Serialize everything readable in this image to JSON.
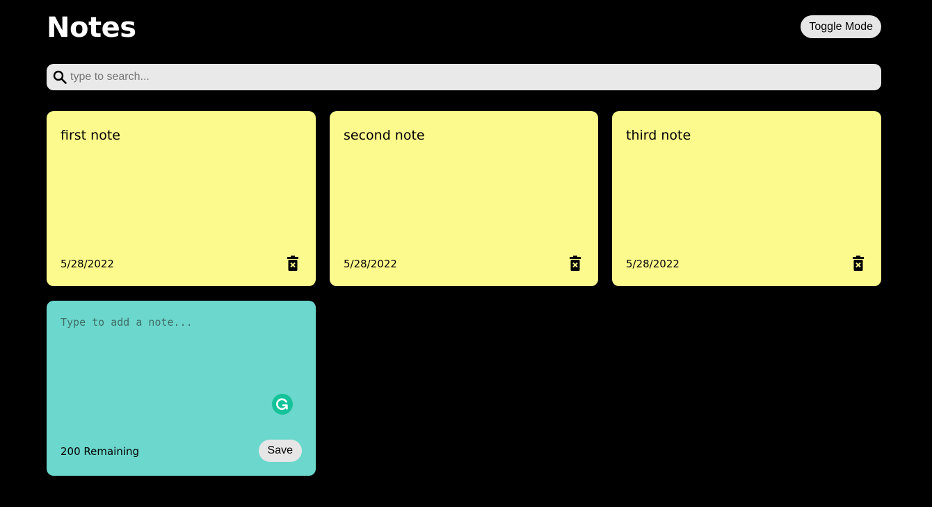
{
  "header": {
    "title": "Notes",
    "toggle_label": "Toggle Mode"
  },
  "search": {
    "placeholder": "type to search...",
    "value": "",
    "icon": "search-icon"
  },
  "notes": [
    {
      "text": "first note",
      "date": "5/28/2022",
      "delete_icon": "trash-icon"
    },
    {
      "text": "second note",
      "date": "5/28/2022",
      "delete_icon": "trash-icon"
    },
    {
      "text": "third note",
      "date": "5/28/2022",
      "delete_icon": "trash-icon"
    }
  ],
  "add_note": {
    "placeholder": "Type to add a note...",
    "value": "",
    "remaining": "200 Remaining",
    "save_label": "Save",
    "assistant_icon": "grammarly-icon"
  },
  "colors": {
    "background": "#000000",
    "note": "#fcfa8c",
    "new_note": "#6cd7cc",
    "button": "#e6e6e6",
    "search": "#e9e9e9",
    "grammarly": "#15c39a"
  }
}
